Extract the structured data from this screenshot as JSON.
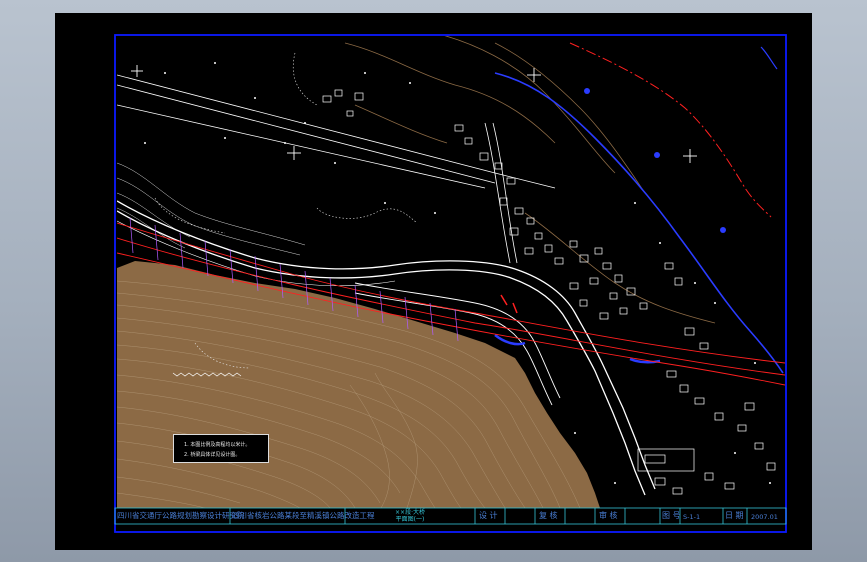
{
  "title_block": {
    "org": "四川省交通厅公路规划勘察设计研究院",
    "project": "四川省核岩公路某段至精溪镇公路改造工程",
    "drawing_line1": "××段·大桥",
    "drawing_line2": "平面图(一)",
    "design_label": "设 计",
    "review_label": "复 核",
    "audit_label": "审 核",
    "drawing_no_label": "图 号",
    "drawing_no": "S-1-1",
    "date_label": "日 期",
    "date": "2007.01"
  },
  "legend": {
    "line1": "1. 本图比例及高程均以米计。",
    "line2": "2. 桥梁具体详见设计图。"
  },
  "colors": {
    "frame": "#0b1aff",
    "terrain": "#8c6a45",
    "road": "#ffffff",
    "centerline": "#ff2020",
    "river": "#2a3cff",
    "titleblock_text": "#4a7fd6"
  }
}
